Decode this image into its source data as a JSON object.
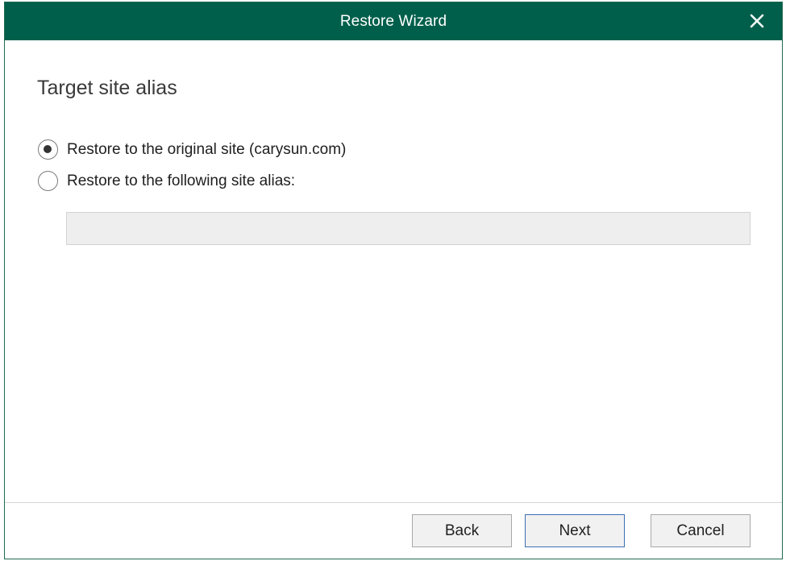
{
  "window": {
    "title": "Restore Wizard",
    "close_icon": "close-icon",
    "titlebar_color": "#005f4b"
  },
  "page": {
    "heading": "Target site alias"
  },
  "options": [
    {
      "label": "Restore to the original site (carysun.com)",
      "checked": true
    },
    {
      "label": "Restore to the following site alias:",
      "checked": false
    }
  ],
  "alias_input": {
    "value": "",
    "placeholder": ""
  },
  "footer": {
    "back_label": "Back",
    "next_label": "Next",
    "cancel_label": "Cancel"
  }
}
